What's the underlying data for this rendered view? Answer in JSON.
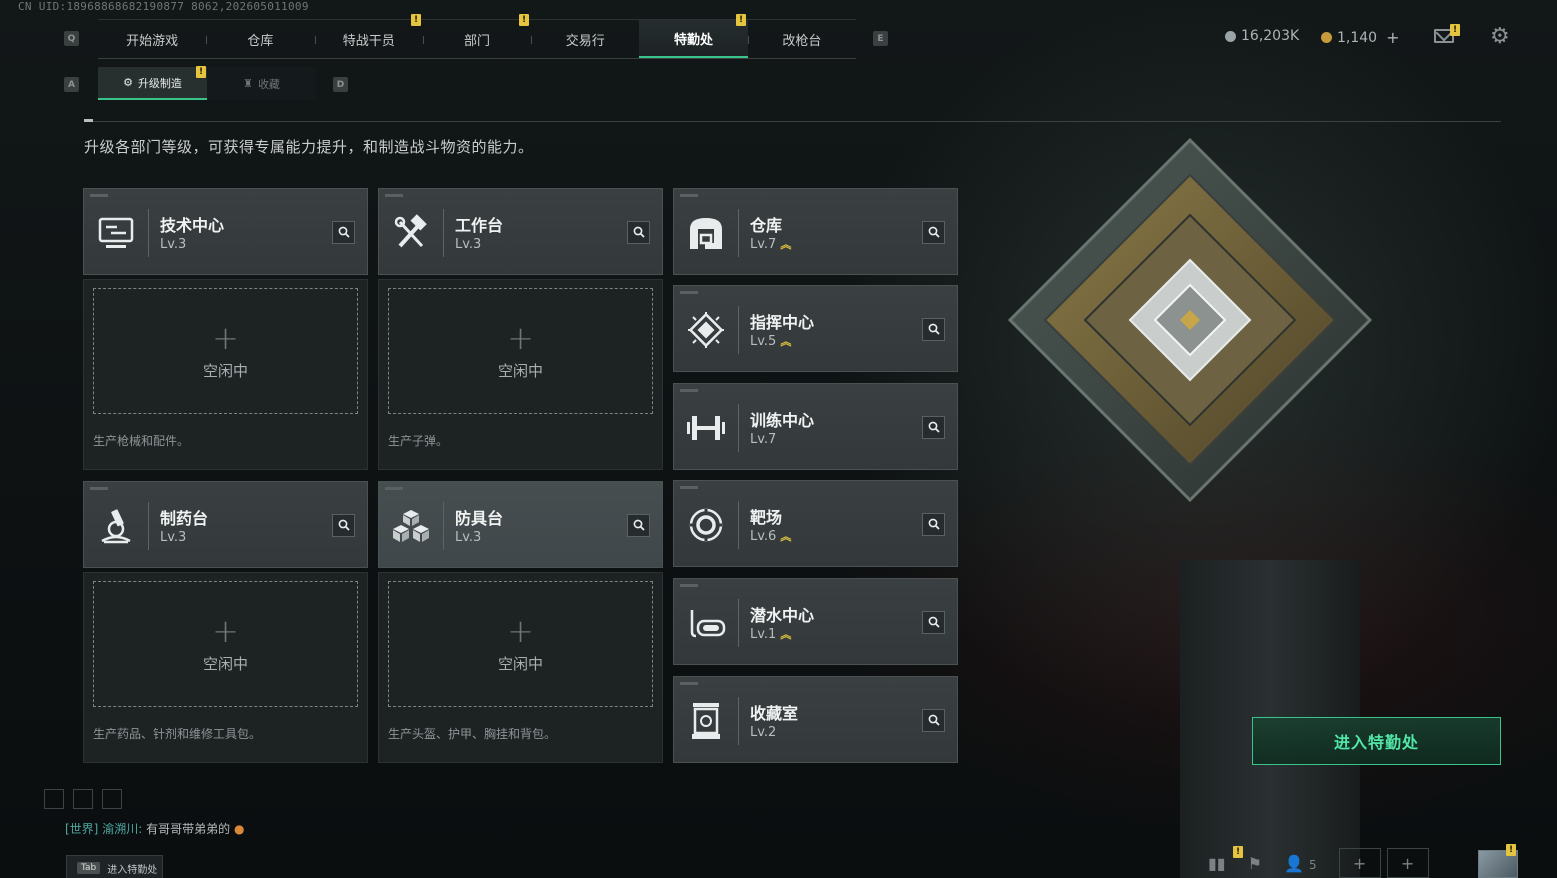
{
  "uid": "CN UID:18968868682190877 8062,202605011009",
  "nav": {
    "key_left": "Q",
    "key_right": "E",
    "tabs": [
      {
        "label": "开始游戏",
        "active": false,
        "badge": false
      },
      {
        "label": "仓库",
        "active": false,
        "badge": false
      },
      {
        "label": "特战干员",
        "active": false,
        "badge": true
      },
      {
        "label": "部门",
        "active": false,
        "badge": true
      },
      {
        "label": "交易行",
        "active": false,
        "badge": false
      },
      {
        "label": "特勤处",
        "active": true,
        "badge": true
      },
      {
        "label": "改枪台",
        "active": false,
        "badge": false
      }
    ],
    "badge_glyph": "!"
  },
  "currency": {
    "silver": "16,203K",
    "gold": "1,140",
    "add": "+",
    "silver_color": "#9aa3a6",
    "gold_color": "#c79a3b"
  },
  "subnav": {
    "key_left": "A",
    "key_right": "D",
    "tabs": [
      {
        "label": "升级制造",
        "active": true
      },
      {
        "label": "收藏",
        "active": false
      }
    ]
  },
  "description": "升级各部门等级，可获得专属能力提升，和制造战斗物资的能力。",
  "production": [
    {
      "name": "技术中心",
      "level": "Lv.3",
      "icon": "computer-icon",
      "idle": "空闲中",
      "plus": "+",
      "desc": "生产枪械和配件。"
    },
    {
      "name": "工作台",
      "level": "Lv.3",
      "icon": "tools-icon",
      "idle": "空闲中",
      "plus": "+",
      "desc": "生产子弹。"
    },
    {
      "name": "制药台",
      "level": "Lv.3",
      "icon": "microscope-icon",
      "idle": "空闲中",
      "plus": "+",
      "desc": "生产药品、针剂和维修工具包。"
    },
    {
      "name": "防具台",
      "level": "Lv.3",
      "icon": "armor-blocks-icon",
      "idle": "空闲中",
      "plus": "+",
      "desc": "生产头盔、护甲、胸挂和背包。"
    }
  ],
  "departments": [
    {
      "name": "仓库",
      "level": "Lv.7",
      "icon": "warehouse-icon",
      "upgradable": true
    },
    {
      "name": "指挥中心",
      "level": "Lv.5",
      "icon": "command-chip-icon",
      "upgradable": true
    },
    {
      "name": "训练中心",
      "level": "Lv.7",
      "icon": "dumbbell-icon",
      "upgradable": false
    },
    {
      "name": "靶场",
      "level": "Lv.6",
      "icon": "target-icon",
      "upgradable": true
    },
    {
      "name": "潜水中心",
      "level": "Lv.1",
      "icon": "diving-mask-icon",
      "upgradable": true
    },
    {
      "name": "收藏室",
      "level": "Lv.2",
      "icon": "collection-case-icon",
      "upgradable": false
    }
  ],
  "upgrade_glyph": "︽",
  "enter_button": "进入特勤处",
  "chat": {
    "channel": "[世界]",
    "user": "渝溯川",
    "message": "有哥哥带弟弟的"
  },
  "tab_hint": {
    "key": "Tab",
    "label": "进入特勤处"
  },
  "friends_count": "5",
  "accent": "#38c48a",
  "badge_color": "#e5c540"
}
